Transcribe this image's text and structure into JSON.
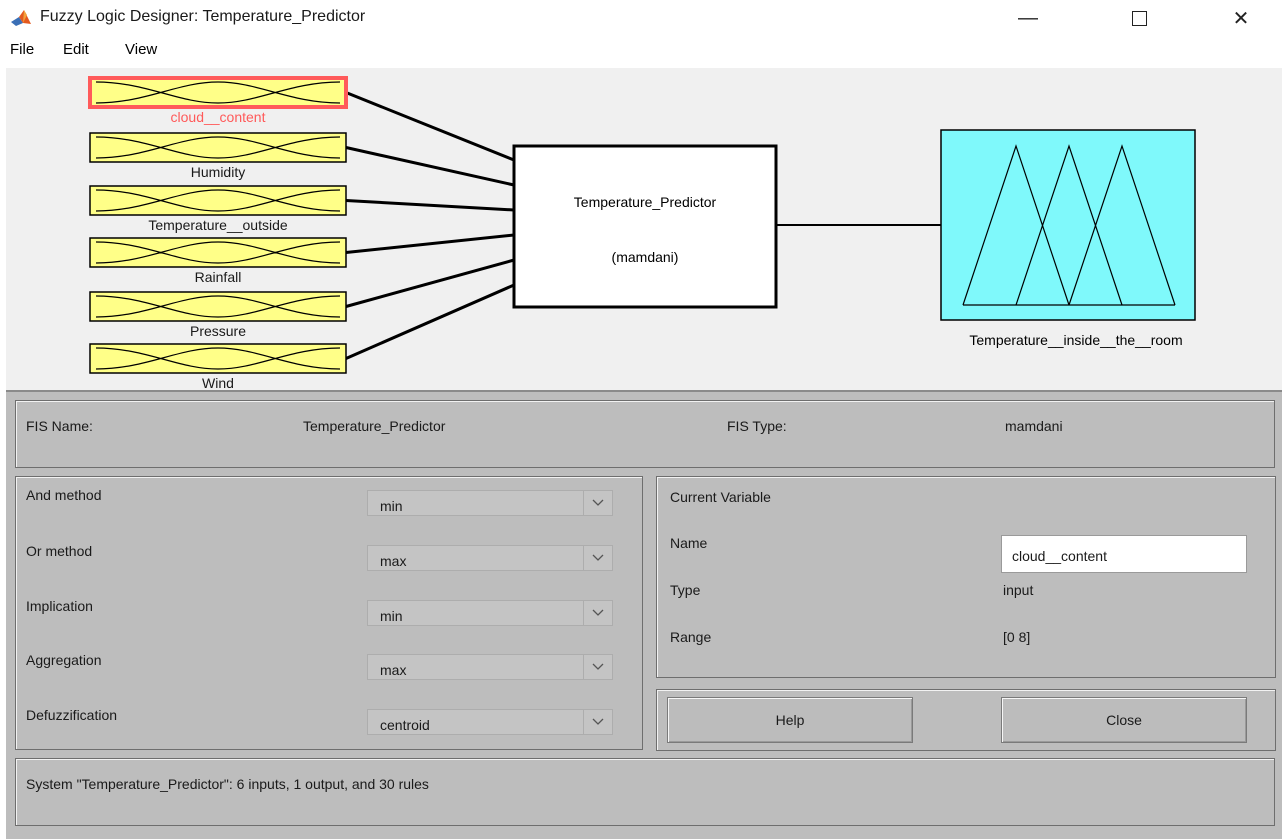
{
  "window": {
    "title": "Fuzzy Logic Designer: Temperature_Predictor"
  },
  "menu": [
    "File",
    "Edit",
    "View"
  ],
  "diagram": {
    "inputs": [
      "cloud__content",
      "Humidity",
      "Temperature__outside",
      "Rainfall",
      "Pressure",
      "Wind"
    ],
    "selected_input": "cloud__content",
    "system_name": "Temperature_Predictor",
    "system_type": "(mamdani)",
    "output_label": "Temperature__inside__the__room",
    "input_color": "#ffff88",
    "output_color": "#7ff9fb",
    "selected_border_color": "#ff5a5a"
  },
  "fis": {
    "name_label": "FIS Name:",
    "name_value": "Temperature_Predictor",
    "type_label": "FIS Type:",
    "type_value": "mamdani"
  },
  "methods": [
    {
      "label": "And method",
      "value": "min"
    },
    {
      "label": "Or method",
      "value": "max"
    },
    {
      "label": "Implication",
      "value": "min"
    },
    {
      "label": "Aggregation",
      "value": "max"
    },
    {
      "label": "Defuzzification",
      "value": "centroid"
    }
  ],
  "current_variable": {
    "title": "Current Variable",
    "name_label": "Name",
    "name_value": "cloud__content",
    "type_label": "Type",
    "type_value": "input",
    "range_label": "Range",
    "range_value": "[0 8]"
  },
  "buttons": {
    "help": "Help",
    "close": "Close"
  },
  "status": "System \"Temperature_Predictor\": 6 inputs, 1 output, and 30 rules"
}
